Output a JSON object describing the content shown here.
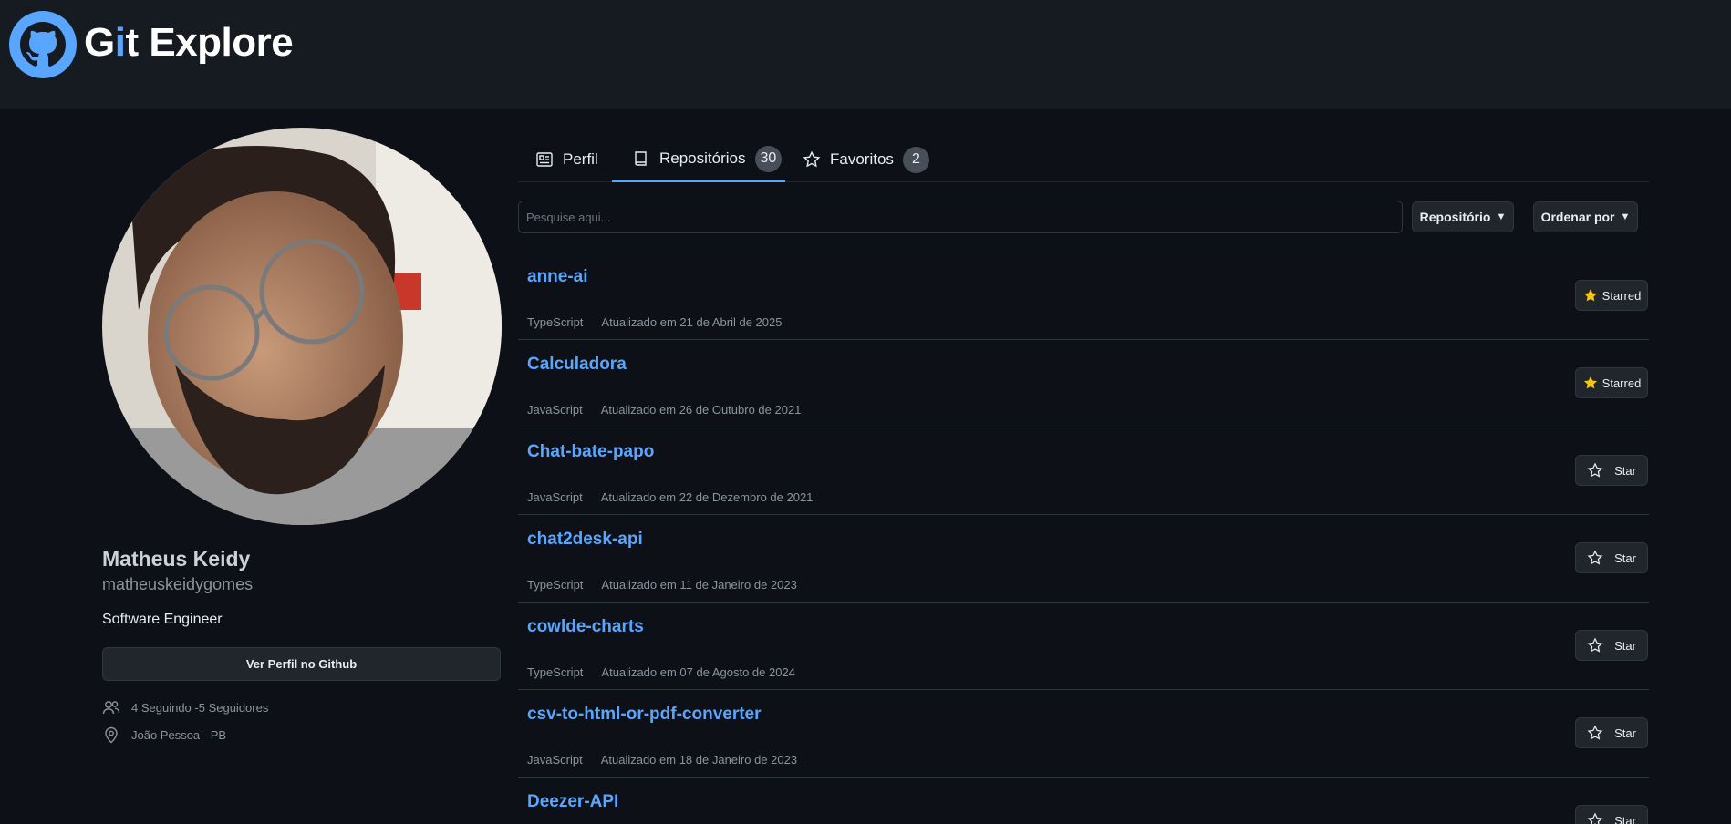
{
  "app": {
    "brand_prefix": "G",
    "brand_accent": "i",
    "brand_suffix": "t Explore"
  },
  "profile": {
    "name": "Matheus Keidy",
    "login": "matheuskeidygomes",
    "bio": "Software Engineer",
    "github_button": "Ver Perfil no Github",
    "follow_text": "4 Seguindo -5 Seguidores",
    "location": "João Pessoa - PB"
  },
  "tabs": [
    {
      "label": "Perfil",
      "icon": "profile-card-icon"
    },
    {
      "label": "Repositórios",
      "icon": "book-icon",
      "count": "30",
      "active": true
    },
    {
      "label": "Favoritos",
      "icon": "star-icon",
      "count": "2"
    }
  ],
  "search": {
    "placeholder": "Pesquise aqui..."
  },
  "filters": {
    "type_label": "Repositório",
    "sort_label": "Ordenar por"
  },
  "repos": [
    {
      "name": "anne-ai",
      "language": "TypeScript",
      "updated": "Atualizado em 21 de Abril de 2025",
      "star_label": "Starred"
    },
    {
      "name": "Calculadora",
      "language": "JavaScript",
      "updated": "Atualizado em 26 de Outubro de 2021",
      "star_label": "Starred"
    },
    {
      "name": "Chat-bate-papo",
      "language": "JavaScript",
      "updated": "Atualizado em 22 de Dezembro de 2021",
      "star_label": "Star"
    },
    {
      "name": "chat2desk-api",
      "language": "TypeScript",
      "updated": "Atualizado em 11 de Janeiro de 2023",
      "star_label": "Star"
    },
    {
      "name": "cowlde-charts",
      "language": "TypeScript",
      "updated": "Atualizado em 07 de Agosto de 2024",
      "star_label": "Star"
    },
    {
      "name": "csv-to-html-or-pdf-converter",
      "language": "JavaScript",
      "updated": "Atualizado em 18 de Janeiro de 2023",
      "star_label": "Star"
    },
    {
      "name": "Deezer-API",
      "language": "",
      "updated": "",
      "star_label": "Star"
    }
  ],
  "colors": {
    "accent": "#58a6ff",
    "star_fill": "#f5c518",
    "background": "#0d1117",
    "header": "#161b22"
  }
}
